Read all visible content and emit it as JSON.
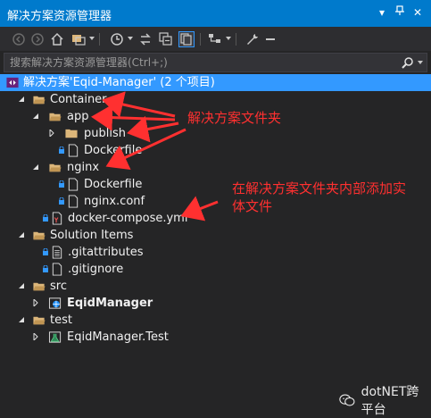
{
  "window": {
    "title": "解决方案资源管理器",
    "pin_glyph": "▾",
    "close_glyph": "✕"
  },
  "search": {
    "placeholder": "搜索解决方案资源管理器(Ctrl+;)"
  },
  "tree": {
    "solution": "解决方案'Eqid-Manager' (2 个项目)",
    "container": "Container",
    "app": "app",
    "publish": "publish",
    "dockerfile_app": "Dockerfile",
    "nginx": "nginx",
    "dockerfile_nginx": "Dockerfile",
    "nginx_conf": "nginx.conf",
    "docker_compose": "docker-compose.yml",
    "solution_items": "Solution Items",
    "gitattributes": ".gitattributes",
    "gitignore": ".gitignore",
    "src": "src",
    "eqid_manager": "EqidManager",
    "test": "test",
    "eqid_manager_test": "EqidManager.Test"
  },
  "annotations": {
    "solution_folder": "解决方案文件夹",
    "add_entity_line1": "在解决方案文件夹内部添加实",
    "add_entity_line2": "体文件"
  },
  "watermark": {
    "text": "dotNET跨平台"
  },
  "colors": {
    "accent": "#007acc",
    "selection": "#3399ff",
    "annotation": "#ff3030",
    "folder": "#dcb67a"
  }
}
